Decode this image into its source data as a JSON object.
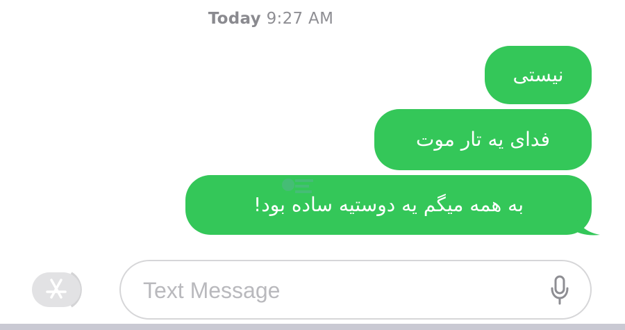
{
  "header": {
    "day": "Today",
    "time": "9:27 AM"
  },
  "messages": [
    {
      "text": "نیستی"
    },
    {
      "text": "فدای یه تار موت"
    },
    {
      "text": "به همه میگم یه دوستیه ساده بود!"
    }
  ],
  "composer": {
    "placeholder": "Text Message"
  },
  "icons": {
    "apps": "app-store-icon",
    "mic": "microphone-icon"
  },
  "colors": {
    "bubble": "#34c759",
    "muted": "#8e8e93"
  }
}
